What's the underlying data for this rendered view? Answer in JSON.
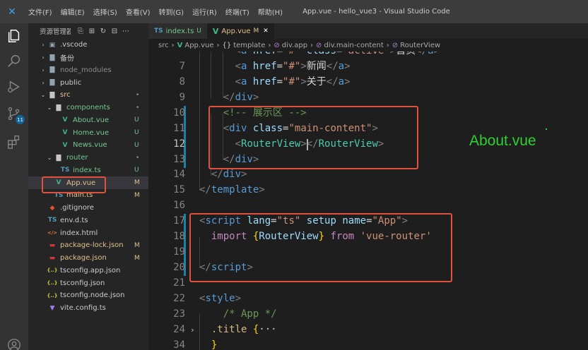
{
  "titlebar": {
    "menu": [
      "文件(F)",
      "编辑(E)",
      "选择(S)",
      "查看(V)",
      "转到(G)",
      "运行(R)",
      "终端(T)",
      "帮助(H)"
    ],
    "window_title": "App.vue - hello_vue3 - Visual Studio Code"
  },
  "activity_bar": {
    "items": [
      "explorer-icon",
      "search-icon",
      "run-debug-icon",
      "source-control-icon",
      "extensions-icon",
      "account-icon"
    ],
    "scm_badge": "11"
  },
  "sidebar": {
    "title": "资源管理器",
    "actions": [
      "new-file-icon",
      "new-folder-icon",
      "refresh-icon",
      "collapse-icon",
      "more-icon"
    ],
    "tree": [
      {
        "label": ".vscode",
        "type": "folder",
        "depth": 0,
        "expanded": false,
        "status": ""
      },
      {
        "label": "备份",
        "type": "folder",
        "depth": 0,
        "expanded": false,
        "status": ""
      },
      {
        "label": "node_modules",
        "type": "folder",
        "depth": 0,
        "expanded": false,
        "status": "",
        "dim": true
      },
      {
        "label": "public",
        "type": "folder",
        "depth": 0,
        "expanded": false,
        "status": ""
      },
      {
        "label": "src",
        "type": "folder",
        "depth": 0,
        "expanded": true,
        "status": "•",
        "state": "mod"
      },
      {
        "label": "components",
        "type": "folder",
        "depth": 1,
        "expanded": true,
        "status": "•",
        "state": "unt"
      },
      {
        "label": "About.vue",
        "type": "vue",
        "depth": 2,
        "status": "U",
        "state": "unt"
      },
      {
        "label": "Home.vue",
        "type": "vue",
        "depth": 2,
        "status": "U",
        "state": "unt"
      },
      {
        "label": "News.vue",
        "type": "vue",
        "depth": 2,
        "status": "U",
        "state": "unt"
      },
      {
        "label": "router",
        "type": "folder",
        "depth": 1,
        "expanded": true,
        "status": "•",
        "state": "unt"
      },
      {
        "label": "index.ts",
        "type": "ts",
        "depth": 2,
        "status": "U",
        "state": "unt"
      },
      {
        "label": "App.vue",
        "type": "vue",
        "depth": 1,
        "status": "M",
        "state": "mod",
        "selected": true
      },
      {
        "label": "main.ts",
        "type": "ts",
        "depth": 1,
        "status": "M",
        "state": "mod"
      },
      {
        "label": ".gitignore",
        "type": "git",
        "depth": 0,
        "status": ""
      },
      {
        "label": "env.d.ts",
        "type": "ts",
        "depth": 0,
        "status": ""
      },
      {
        "label": "index.html",
        "type": "html",
        "depth": 0,
        "status": ""
      },
      {
        "label": "package-lock.json",
        "type": "npm",
        "depth": 0,
        "status": "M",
        "state": "mod"
      },
      {
        "label": "package.json",
        "type": "npm",
        "depth": 0,
        "status": "M",
        "state": "mod"
      },
      {
        "label": "tsconfig.app.json",
        "type": "json",
        "depth": 0,
        "status": ""
      },
      {
        "label": "tsconfig.json",
        "type": "json",
        "depth": 0,
        "status": ""
      },
      {
        "label": "tsconfig.node.json",
        "type": "json",
        "depth": 0,
        "status": ""
      },
      {
        "label": "vite.config.ts",
        "type": "vite",
        "depth": 0,
        "status": ""
      }
    ]
  },
  "tabs": [
    {
      "icon": "TS",
      "label": "index.ts",
      "status": "U",
      "active": false
    },
    {
      "icon": "V",
      "label": "App.vue",
      "status": "M",
      "active": true,
      "close": "✕"
    }
  ],
  "breadcrumbs": [
    {
      "label": "src",
      "icon": ""
    },
    {
      "label": "App.vue",
      "icon": "V"
    },
    {
      "label": "template",
      "icon": "{}"
    },
    {
      "label": "div.app",
      "icon": "⊘"
    },
    {
      "label": "div.main-content",
      "icon": "⊘"
    },
    {
      "label": "RouterView",
      "icon": "⊘"
    }
  ],
  "editor": {
    "current_line": "12",
    "lines": [
      {
        "n": "",
        "tokens": [
          [
            "t-br",
            "      <"
          ],
          [
            "t-tag",
            "a "
          ],
          [
            "t-attr",
            "href"
          ],
          [
            "t-txt",
            "="
          ],
          [
            "t-str",
            "\"#\" "
          ],
          [
            "t-attr",
            "class"
          ],
          [
            "t-txt",
            "="
          ],
          [
            "t-str",
            "\"active\""
          ],
          [
            "t-br",
            ">"
          ],
          [
            "t-txt",
            "首页"
          ],
          [
            "t-br",
            "</"
          ],
          [
            "t-tag",
            "a"
          ],
          [
            "t-br",
            ">"
          ]
        ]
      },
      {
        "n": "7",
        "tokens": [
          [
            "t-br",
            "      <"
          ],
          [
            "t-tag",
            "a "
          ],
          [
            "t-attr",
            "href"
          ],
          [
            "t-txt",
            "="
          ],
          [
            "t-str",
            "\"#\""
          ],
          [
            "t-br",
            ">"
          ],
          [
            "t-txt",
            "新闻"
          ],
          [
            "t-br",
            "</"
          ],
          [
            "t-tag",
            "a"
          ],
          [
            "t-br",
            ">"
          ]
        ]
      },
      {
        "n": "8",
        "tokens": [
          [
            "t-br",
            "      <"
          ],
          [
            "t-tag",
            "a "
          ],
          [
            "t-attr",
            "href"
          ],
          [
            "t-txt",
            "="
          ],
          [
            "t-str",
            "\"#\""
          ],
          [
            "t-br",
            ">"
          ],
          [
            "t-txt",
            "关于"
          ],
          [
            "t-br",
            "</"
          ],
          [
            "t-tag",
            "a"
          ],
          [
            "t-br",
            ">"
          ]
        ]
      },
      {
        "n": "9",
        "tokens": [
          [
            "t-br",
            "    </"
          ],
          [
            "t-tag",
            "div"
          ],
          [
            "t-br",
            ">"
          ]
        ]
      },
      {
        "n": "10",
        "tokens": [
          [
            "t-cmt",
            "    <!-- 展示区 -->"
          ]
        ]
      },
      {
        "n": "11",
        "tokens": [
          [
            "t-br",
            "    <"
          ],
          [
            "t-tag",
            "div "
          ],
          [
            "t-attr",
            "class"
          ],
          [
            "t-txt",
            "="
          ],
          [
            "t-str",
            "\"main-content\""
          ],
          [
            "t-br",
            ">"
          ]
        ]
      },
      {
        "n": "12",
        "tokens": [
          [
            "t-br",
            "      <"
          ],
          [
            "t-cmp",
            "RouterView"
          ],
          [
            "t-br",
            "></"
          ],
          [
            "t-cmp",
            "RouterView"
          ],
          [
            "t-br",
            ">"
          ]
        ]
      },
      {
        "n": "13",
        "tokens": [
          [
            "t-br",
            "    </"
          ],
          [
            "t-tag",
            "div"
          ],
          [
            "t-br",
            ">"
          ]
        ]
      },
      {
        "n": "14",
        "tokens": [
          [
            "t-br",
            "  </"
          ],
          [
            "t-tag",
            "div"
          ],
          [
            "t-br",
            ">"
          ]
        ]
      },
      {
        "n": "15",
        "tokens": [
          [
            "t-br",
            "</"
          ],
          [
            "t-tag",
            "template"
          ],
          [
            "t-br",
            ">"
          ]
        ]
      },
      {
        "n": "16",
        "tokens": []
      },
      {
        "n": "17",
        "tokens": [
          [
            "t-br",
            "<"
          ],
          [
            "t-tag",
            "script "
          ],
          [
            "t-attr",
            "lang"
          ],
          [
            "t-txt",
            "="
          ],
          [
            "t-str",
            "\"ts\" "
          ],
          [
            "t-attr",
            "setup "
          ],
          [
            "t-attr",
            "name"
          ],
          [
            "t-txt",
            "="
          ],
          [
            "t-str",
            "\"App\""
          ],
          [
            "t-br",
            ">"
          ]
        ]
      },
      {
        "n": "18",
        "tokens": [
          [
            "t-kw",
            "  import "
          ],
          [
            "t-brk",
            "{"
          ],
          [
            "t-attr",
            "RouterView"
          ],
          [
            "t-brk",
            "}"
          ],
          [
            "t-kw",
            " from "
          ],
          [
            "t-str",
            "'vue-router'"
          ]
        ]
      },
      {
        "n": "19",
        "tokens": []
      },
      {
        "n": "20",
        "tokens": [
          [
            "t-br",
            "</"
          ],
          [
            "t-tag",
            "script"
          ],
          [
            "t-br",
            ">"
          ]
        ]
      },
      {
        "n": "21",
        "tokens": []
      },
      {
        "n": "22",
        "tokens": [
          [
            "t-br",
            "<"
          ],
          [
            "t-tag",
            "style"
          ],
          [
            "t-br",
            ">"
          ]
        ]
      },
      {
        "n": "23",
        "tokens": [
          [
            "t-cmt",
            "    /* App */"
          ]
        ]
      },
      {
        "n": "24",
        "tokens": [
          [
            "t-sel",
            "  .title "
          ],
          [
            "t-brk",
            "{"
          ],
          [
            "t-ell",
            "···"
          ]
        ]
      },
      {
        "n": "34",
        "tokens": [
          [
            "t-brk",
            "  }"
          ]
        ]
      }
    ]
  },
  "annotation": {
    "about_label": "About.vue",
    "box_color": "#e0513f",
    "label_color": "#2fd02f"
  }
}
